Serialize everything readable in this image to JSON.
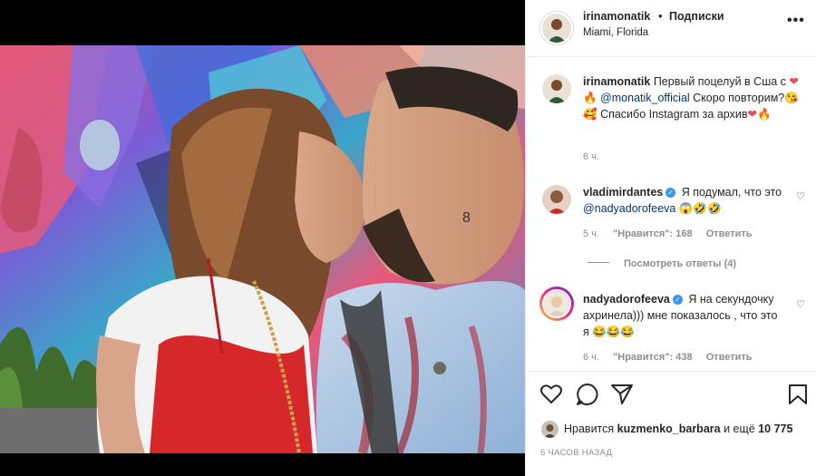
{
  "post": {
    "author": "irinamonatik",
    "follow_separator": "•",
    "follow_label": "Подписки",
    "location": "Miami, Florida",
    "more_label": "•••"
  },
  "caption": {
    "author": "irinamonatik",
    "text_1": "Первый поцелуй в Сша с",
    "mention": "@monatik_official",
    "text_2": "Скоро повторим?",
    "text_3": "Спасибо Instagram за архив",
    "time": "6 ч."
  },
  "comments": [
    {
      "author": "vladimirdantes",
      "text_1": "Я подумал, что это",
      "mention": "@nadyadorofeeva",
      "time": "5 ч.",
      "likes": "\"Нравится\": 168",
      "reply": "Ответить"
    },
    {
      "author": "nadyadorofeeva",
      "text_1": "Я на секундочку ахринела))) мне показалось , что это я",
      "time": "6 ч.",
      "likes": "\"Нравится\": 438",
      "reply": "Ответить"
    }
  ],
  "view_replies": "Посмотреть ответы (4)",
  "likes_line": {
    "prefix": "Нравится",
    "user": "kuzmenko_barbara",
    "suffix": "и ещё",
    "count": "10 775"
  },
  "timestamp": "6 ЧАСОВ НАЗАД",
  "colors": {
    "mention": "#00376b",
    "verified": "#3897f0",
    "muted": "#8e8e8e",
    "heart": "#ed4956"
  },
  "icons": [
    "more-icon",
    "heart-icon",
    "comment-icon",
    "share-icon",
    "bookmark-icon",
    "verified-icon"
  ]
}
